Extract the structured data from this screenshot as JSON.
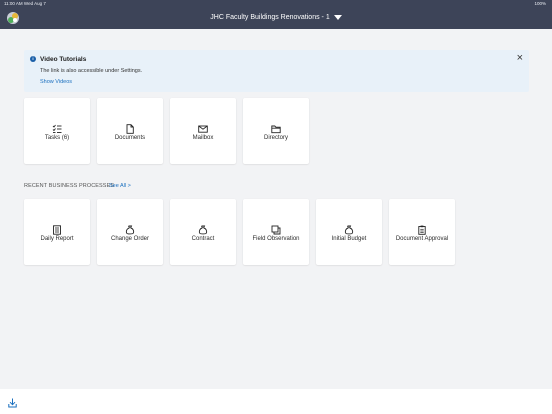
{
  "status_bar": {
    "time": "11:00 AM  Wed Aug 7",
    "battery": "100%"
  },
  "header": {
    "title": "JHC Faculty Buildings Renovations - 1"
  },
  "banner": {
    "title": "Video Tutorials",
    "text": "The link is also accessible under Settings.",
    "link": "Show Videos",
    "close_glyph": "×"
  },
  "quick_access": [
    {
      "label": "Tasks (6)",
      "icon": "tasks-icon"
    },
    {
      "label": "Documents",
      "icon": "document-icon"
    },
    {
      "label": "Mailbox",
      "icon": "mail-icon"
    },
    {
      "label": "Directory",
      "icon": "folder-icon"
    }
  ],
  "recent": {
    "label": "RECENT BUSINESS PROCESSES",
    "see_all": "See All >",
    "items": [
      {
        "label": "Daily Report",
        "icon": "report-icon"
      },
      {
        "label": "Change Order",
        "icon": "money-bag-icon"
      },
      {
        "label": "Contract",
        "icon": "money-bag-icon"
      },
      {
        "label": "Field Observation",
        "icon": "copy-icon"
      },
      {
        "label": "Initial Budget",
        "icon": "money-bag-icon"
      },
      {
        "label": "Document Approval",
        "icon": "clipboard-icon"
      }
    ]
  },
  "footer": {
    "icon": "download-icon"
  },
  "colors": {
    "nav": "#3d4458",
    "accent": "#1a6fbf",
    "banner_bg": "#e8f1f9"
  }
}
